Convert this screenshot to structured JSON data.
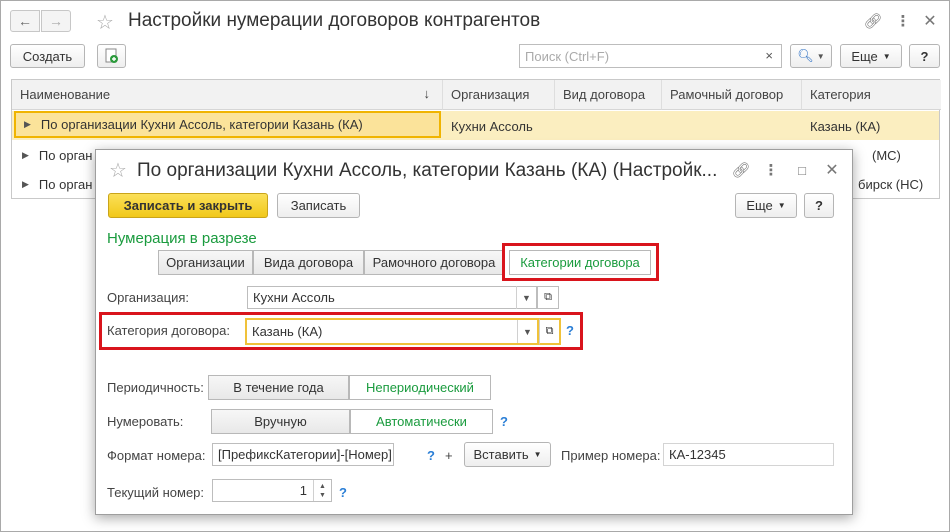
{
  "main": {
    "title": "Настройки нумерации договоров контрагентов",
    "create_label": "Создать",
    "search_placeholder": "Поиск (Ctrl+F)",
    "search_clear": "×",
    "more_label": "Еще",
    "help_label": "?",
    "columns": [
      "Наименование",
      "Организация",
      "Вид договора",
      "Рамочный договор",
      "Категория"
    ],
    "rows": [
      {
        "name": "По организации Кухни Ассоль, категории Казань (КА)",
        "org": "Кухни Ассоль",
        "type": "",
        "frame": "",
        "category": "Казань (КА)"
      },
      {
        "name": "По орган",
        "org": "",
        "type": "",
        "frame": "",
        "category": "(МС)"
      },
      {
        "name": "По орган",
        "org": "",
        "type": "",
        "frame": "",
        "category": "бирск (НС)"
      }
    ]
  },
  "dialog": {
    "title": "По организации Кухни Ассоль, категории Казань (КА) (Настройк...",
    "save_close": "Записать и закрыть",
    "save": "Записать",
    "more_label": "Еще",
    "help_label": "?",
    "section_title": "Нумерация в разрезе",
    "tabs": [
      "Организации",
      "Вида договора",
      "Рамочного договора",
      "Категории договора"
    ],
    "org_label": "Организация:",
    "org_value": "Кухни Ассоль",
    "category_label": "Категория договора:",
    "category_value": "Казань (КА)",
    "period_label": "Периодичность:",
    "period_options": [
      "В течение года",
      "Непериодический"
    ],
    "numbering_label": "Нумеровать:",
    "numbering_options": [
      "Вручную",
      "Автоматически"
    ],
    "format_label": "Формат номера:",
    "format_value": "[ПрефиксКатегории]-[Номер]",
    "plus": "+",
    "insert_label": "Вставить",
    "example_label": "Пример номера:",
    "example_value": "КА-12345",
    "current_label": "Текущий номер:",
    "current_value": "1",
    "q": "?"
  },
  "colors": {
    "accent_green": "#1a9b3e",
    "highlight_red": "#d9141c",
    "selected_row": "#fbeec0",
    "primary_yellow": "#f7d52a"
  }
}
